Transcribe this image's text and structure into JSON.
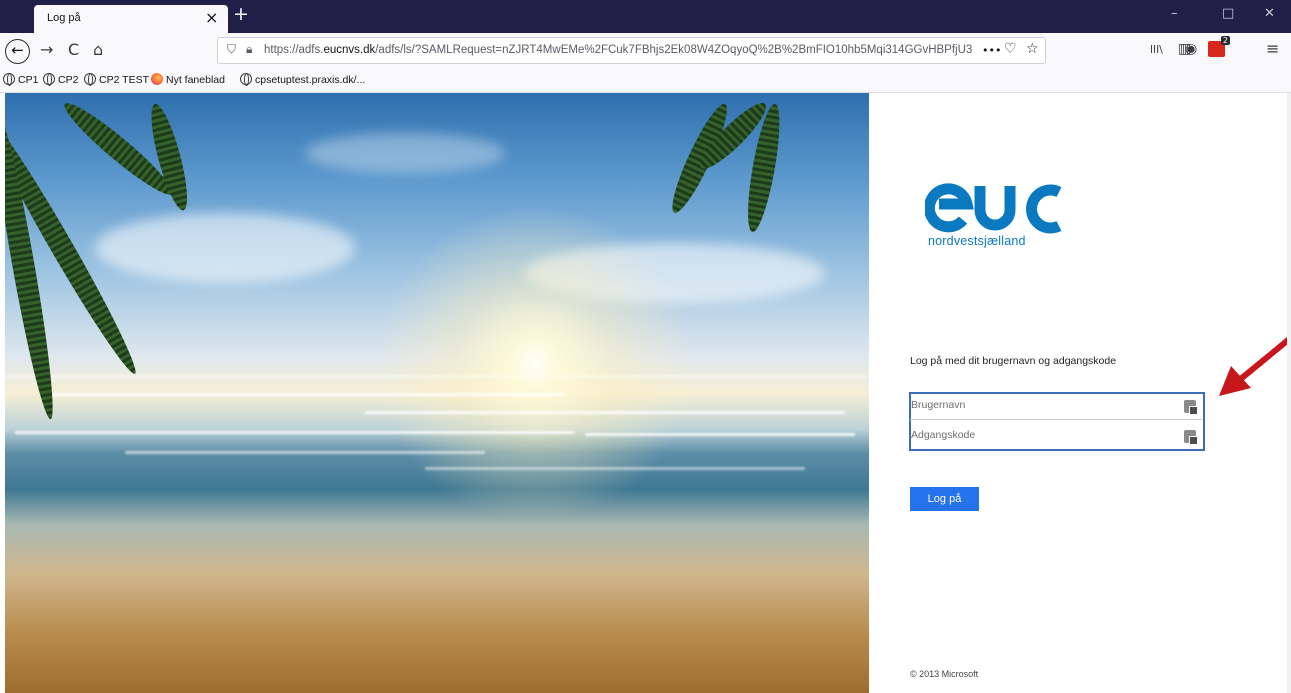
{
  "browser": {
    "tab_title": "Log på",
    "tab_close": "×",
    "new_tab": "+",
    "window_controls": {
      "minimize": "–",
      "maximize": "□",
      "close": "✕"
    },
    "nav": {
      "back": "←",
      "forward": "→",
      "reload": "C",
      "home": "⌂"
    },
    "url_prefix": "https://adfs.",
    "url_domain": "eucnvs.dk",
    "url_rest": "/adfs/ls/?SAMLRequest=nZJRT4MwEMe%2FCuk7FBhjs2Ek08W4ZOqyoQ%2B%2BmFIO10hb5Mqi314GGvHBPfjU3",
    "url_actions": {
      "more": "•••",
      "pocket": "♡",
      "bookmark": "☆"
    },
    "toolbar_right": {
      "library": "lll\\",
      "sidebar": "▥",
      "account": "◉",
      "menu": "≡"
    },
    "extension_badge": "2",
    "bookmarks": [
      "CP1",
      "CP2",
      "CP2 TEST",
      "Nyt faneblad",
      "cpsetuptest.praxis.dk/..."
    ]
  },
  "login": {
    "logo_text": "euc",
    "logo_subtitle": "nordvestsjælland",
    "prompt": "Log på med dit brugernavn og adgangskode",
    "username_placeholder": "Brugernavn",
    "password_placeholder": "Adgangskode",
    "submit_label": "Log på",
    "copyright": "© 2013 Microsoft"
  },
  "colors": {
    "brand_blue": "#0a79c0",
    "button_blue": "#2672ec",
    "field_highlight": "#3b6fb5",
    "annotation_arrow": "#c8161d"
  }
}
